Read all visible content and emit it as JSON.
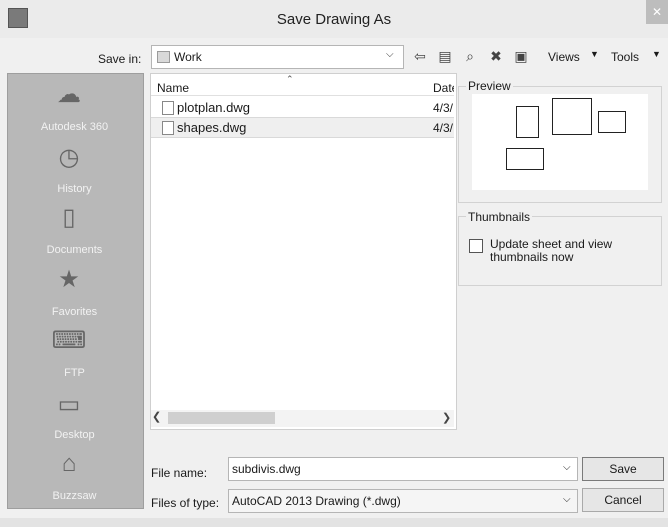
{
  "window": {
    "title": "Save Drawing As",
    "close_glyph": "✕"
  },
  "toolbar": {
    "save_in_label": "Save in:",
    "save_in_value": "Work",
    "views_label": "Views",
    "tools_label": "Tools",
    "icons": [
      "back-icon",
      "up-folder-icon",
      "search-web-icon",
      "delete-icon",
      "new-folder-icon"
    ]
  },
  "places": [
    {
      "label": "Autodesk 360",
      "icon": "cloud-icon"
    },
    {
      "label": "History",
      "icon": "history-icon"
    },
    {
      "label": "Documents",
      "icon": "documents-icon"
    },
    {
      "label": "Favorites",
      "icon": "favorites-icon"
    },
    {
      "label": "FTP",
      "icon": "ftp-icon"
    },
    {
      "label": "Desktop",
      "icon": "desktop-icon"
    },
    {
      "label": "Buzzsaw",
      "icon": "buzzsaw-icon"
    }
  ],
  "file_list": {
    "columns": [
      "Name",
      "Date"
    ],
    "rows": [
      {
        "name": "plotplan.dwg",
        "date": "4/3/"
      },
      {
        "name": "shapes.dwg",
        "date": "4/3/"
      }
    ],
    "selected_index": 1
  },
  "preview": {
    "label": "Preview"
  },
  "thumbnails": {
    "label": "Thumbnails",
    "checkbox_label": "Update sheet and view thumbnails now",
    "checked": false
  },
  "form": {
    "file_name_label": "File name:",
    "file_name_value": "subdivis.dwg",
    "file_type_label": "Files of type:",
    "file_type_value": "AutoCAD 2013 Drawing (*.dwg)"
  },
  "buttons": {
    "save": "Save",
    "cancel": "Cancel"
  }
}
